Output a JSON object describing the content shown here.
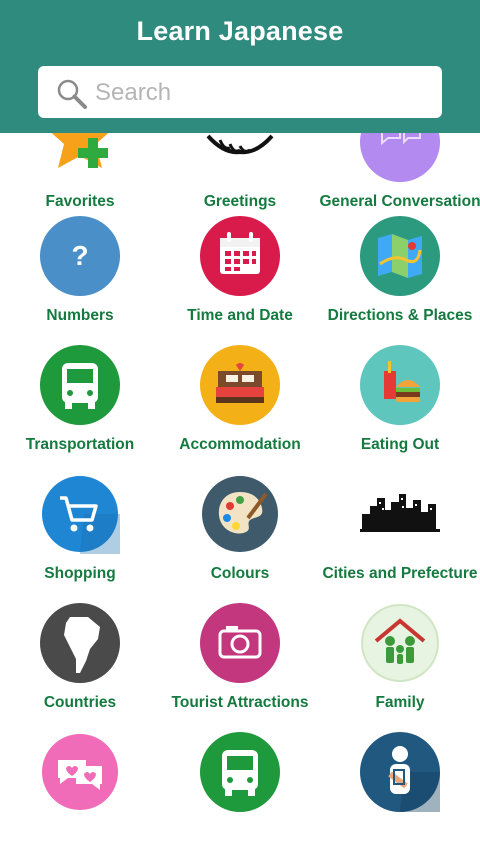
{
  "header": {
    "title": "Learn Japanese",
    "search_placeholder": "Search",
    "color": "#2e8b7e"
  },
  "categories": [
    {
      "label": "Favorites",
      "icon": "favorites-star-plus-icon"
    },
    {
      "label": "Greetings",
      "icon": "handshake-icon"
    },
    {
      "label": "General Conversation",
      "icon": "speech-bubbles-icon"
    },
    {
      "label": "Numbers",
      "icon": "question-mark-icon"
    },
    {
      "label": "Time and Date",
      "icon": "calendar-icon"
    },
    {
      "label": "Directions & Places",
      "icon": "map-icon"
    },
    {
      "label": "Transportation",
      "icon": "bus-icon"
    },
    {
      "label": "Accommodation",
      "icon": "bed-icon"
    },
    {
      "label": "Eating Out",
      "icon": "burger-drink-icon"
    },
    {
      "label": "Shopping",
      "icon": "shopping-cart-icon"
    },
    {
      "label": "Colours",
      "icon": "paint-palette-icon"
    },
    {
      "label": "Cities and Prefecture",
      "icon": "city-skyline-icon"
    },
    {
      "label": "Countries",
      "icon": "south-america-map-icon"
    },
    {
      "label": "Tourist Attractions",
      "icon": "camera-icon"
    },
    {
      "label": "Family",
      "icon": "family-house-icon"
    },
    {
      "label": "",
      "icon": "chat-hearts-icon"
    },
    {
      "label": "",
      "icon": "bus-icon"
    },
    {
      "label": "",
      "icon": "injured-person-icon"
    }
  ],
  "colors": {
    "label": "#147a3f",
    "numbers": "#4a8fc8",
    "time_and_date": "#d81b4a",
    "directions": "#2c9a7e",
    "transportation": "#1e9a3c",
    "accommodation": "#f3b117",
    "eating_out": "#5fc6bd",
    "shopping": "#1f86d4",
    "colours": "#3e5a6b",
    "countries": "#4a4a4a",
    "tourist": "#c2377e",
    "family": "#e8f4e2",
    "chat": "#f06bb8",
    "injury": "#20587f"
  }
}
